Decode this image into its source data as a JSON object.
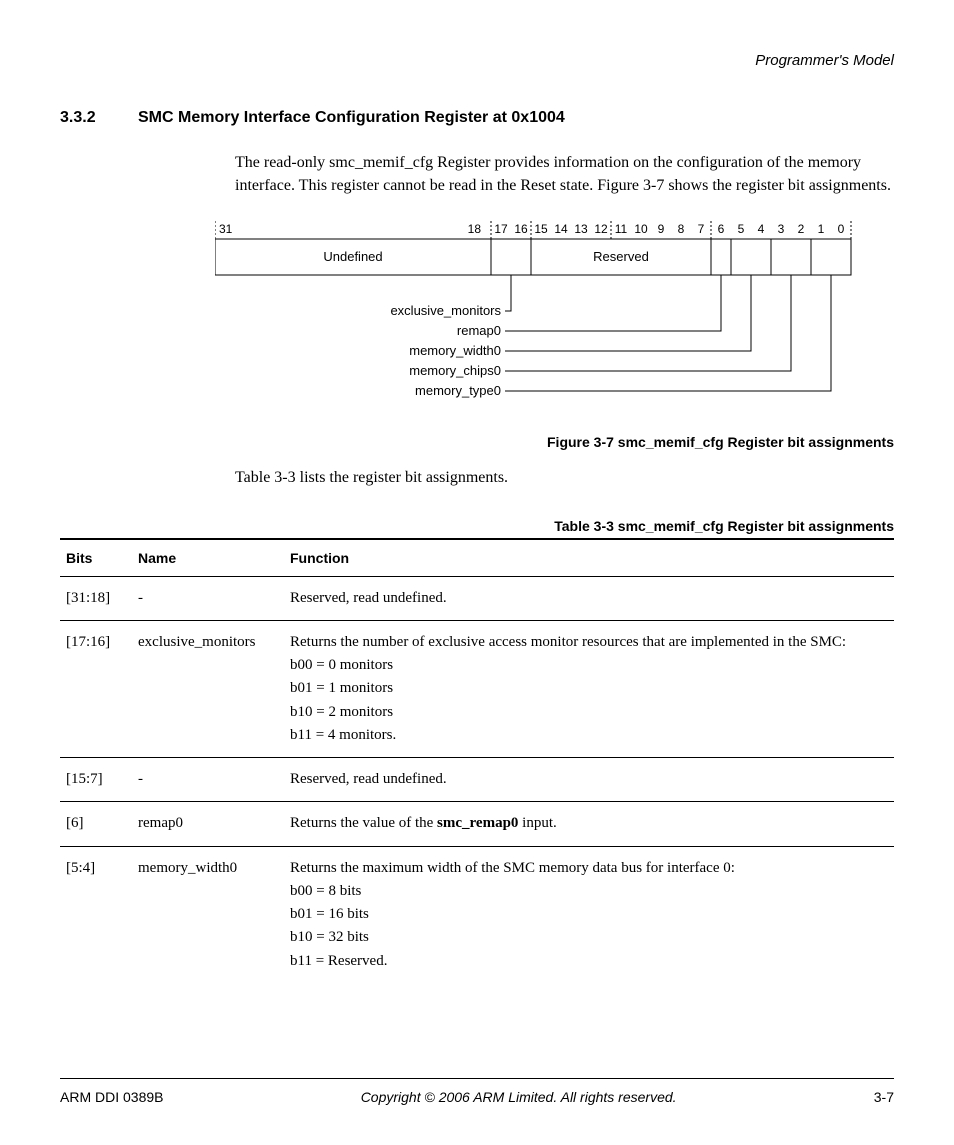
{
  "header": {
    "chapter": "Programmer's Model"
  },
  "section": {
    "num": "3.3.2",
    "title": "SMC Memory Interface Configuration Register at 0x1004",
    "intro": "The read-only smc_memif_cfg Register provides information on the configuration of the memory interface. This register cannot be read in the Reset state. Figure 3-7 shows the register bit assignments.",
    "after_fig": "Table 3-3 lists the register bit assignments."
  },
  "figure": {
    "caption": "Figure 3-7 smc_memif_cfg Register bit assignments",
    "bits": [
      "31",
      "18",
      "17",
      "16",
      "15",
      "14",
      "13",
      "12",
      "11",
      "10",
      "9",
      "8",
      "7",
      "6",
      "5",
      "4",
      "3",
      "2",
      "1",
      "0"
    ],
    "boxes": {
      "undefined": "Undefined",
      "reserved": "Reserved"
    },
    "labels": {
      "exclusive_monitors": "exclusive_monitors",
      "remap0": "remap0",
      "memory_width0": "memory_width0",
      "memory_chips0": "memory_chips0",
      "memory_type0": "memory_type0"
    }
  },
  "table": {
    "caption": "Table 3-3 smc_memif_cfg Register bit assignments",
    "headers": {
      "bits": "Bits",
      "name": "Name",
      "function": "Function"
    },
    "rows": [
      {
        "bits": "[31:18]",
        "name": "-",
        "function_lines": [
          "Reserved, read undefined."
        ]
      },
      {
        "bits": "[17:16]",
        "name": "exclusive_monitors",
        "function_lines": [
          "Returns the number of exclusive access monitor resources that are implemented in the SMC:",
          "b00 = 0 monitors",
          "b01 = 1 monitors",
          "b10 = 2 monitors",
          "b11 = 4 monitors."
        ]
      },
      {
        "bits": "[15:7]",
        "name": "-",
        "function_lines": [
          "Reserved, read undefined."
        ]
      },
      {
        "bits": "[6]",
        "name": "remap0",
        "function_html": "Returns the value of the <b>smc_remap0</b> input."
      },
      {
        "bits": "[5:4]",
        "name": "memory_width0",
        "function_lines": [
          "Returns the maximum width of the SMC memory data bus for interface 0:",
          "b00 = 8 bits",
          "b01 = 16 bits",
          "b10 = 32 bits",
          "b11 = Reserved."
        ]
      }
    ]
  },
  "footer": {
    "left": "ARM DDI 0389B",
    "center": "Copyright © 2006 ARM Limited. All rights reserved.",
    "right": "3-7"
  }
}
